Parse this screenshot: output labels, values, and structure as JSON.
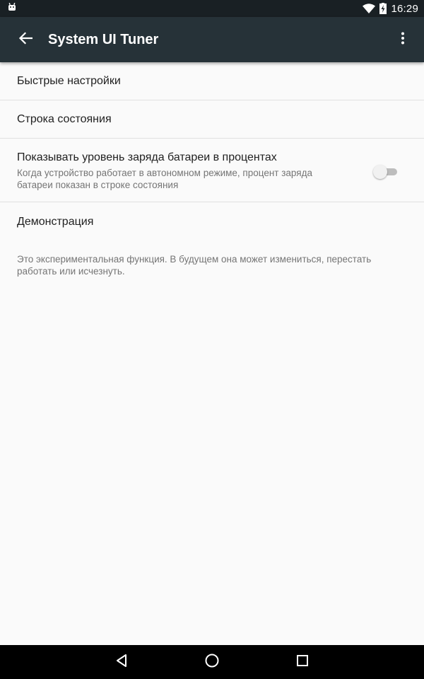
{
  "status_bar": {
    "time": "16:29",
    "notification_icon": "android-icon",
    "wifi_icon": "wifi-icon",
    "battery_icon": "battery-charging-icon"
  },
  "toolbar": {
    "title": "System UI Tuner",
    "back_icon": "arrow-back-icon",
    "menu_icon": "more-vert-icon"
  },
  "preferences": [
    {
      "title": "Быстрые настройки"
    },
    {
      "title": "Строка состояния"
    },
    {
      "title": "Показывать уровень заряда батареи в процентах",
      "summary": "Когда устройство работает в автономном режиме, процент заряда батареи показан в строке состояния",
      "switch_on": false
    },
    {
      "title": "Демонстрация"
    }
  ],
  "footer_note": "Это экспериментальная функция. В будущем она может измениться, перестать работать или исчезнуть.",
  "nav_bar": {
    "back_icon": "nav-back-icon",
    "home_icon": "nav-home-icon",
    "recents_icon": "nav-recents-icon"
  },
  "colors": {
    "status_bar": "#192024",
    "toolbar": "#263238",
    "background": "#fafafa",
    "divider": "#e0e0e0",
    "primary_text": "#212121",
    "secondary_text": "#757575"
  }
}
